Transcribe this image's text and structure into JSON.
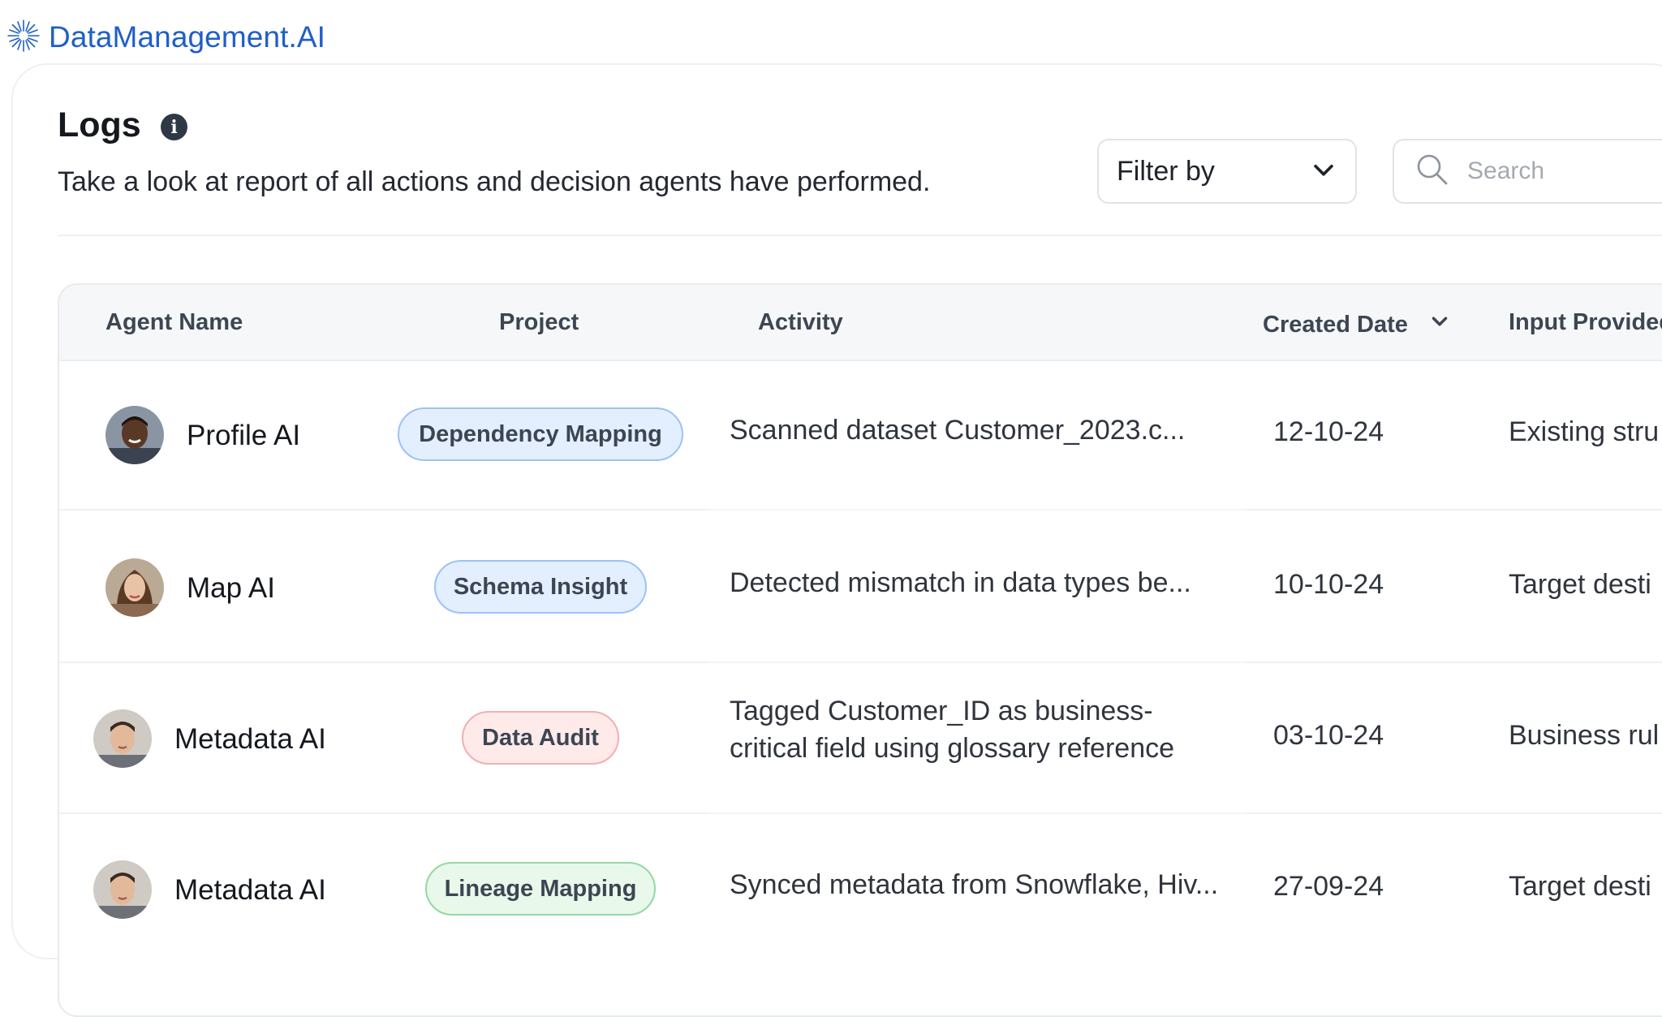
{
  "brand": {
    "name": "DataManagement.AI",
    "color": "#1f5fc8"
  },
  "page": {
    "title": "Logs",
    "info_icon": "i",
    "subtitle": "Take a look at report of all actions and decision agents have performed."
  },
  "toolbar": {
    "filter_label": "Filter by",
    "search_placeholder": "Search"
  },
  "table": {
    "columns": {
      "agent_name": "Agent Name",
      "project": "Project",
      "activity": "Activity",
      "created_date": "Created Date",
      "input_provided": "Input Provided"
    },
    "rows": [
      {
        "agent": "Profile AI",
        "project": "Dependency Mapping",
        "project_color": "blue",
        "activity": "Scanned dataset Customer_2023.c...",
        "date": "12-10-24",
        "input": "Existing stru"
      },
      {
        "agent": "Map AI",
        "project": "Schema Insight",
        "project_color": "blue",
        "activity": "Detected mismatch in data types be...",
        "date": "10-10-24",
        "input": "Target desti"
      },
      {
        "agent": "Metadata AI",
        "project": "Data Audit",
        "project_color": "red",
        "activity": "Tagged Customer_ID as business-critical field using glossary reference",
        "date": "03-10-24",
        "input": "Business rul"
      },
      {
        "agent": "Metadata AI",
        "project": "Lineage Mapping",
        "project_color": "green",
        "activity": "Synced metadata from Snowflake, Hiv...",
        "date": "27-09-24",
        "input": "Target desti"
      }
    ]
  }
}
